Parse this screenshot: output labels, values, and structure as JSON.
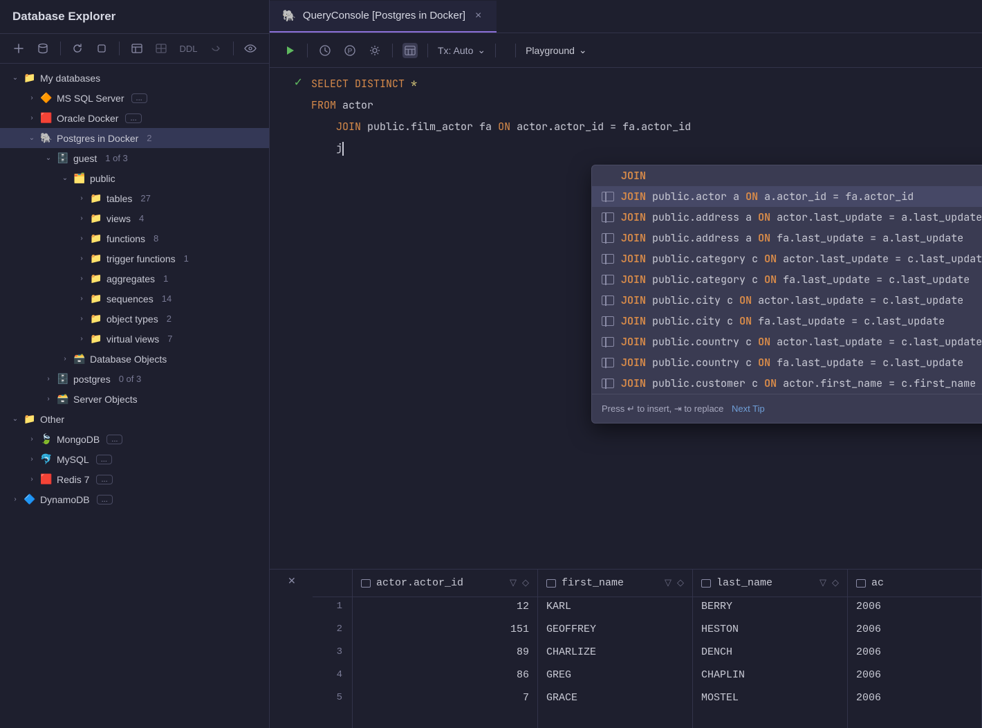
{
  "sidebar": {
    "title": "Database Explorer",
    "toolbar": {
      "ddl": "DDL"
    },
    "tree": [
      {
        "depth": 0,
        "expanded": true,
        "icon": "folder",
        "label": "My databases"
      },
      {
        "depth": 1,
        "expanded": false,
        "icon": "mssql",
        "label": "MS SQL Server",
        "badge": "..."
      },
      {
        "depth": 1,
        "expanded": false,
        "icon": "oracle",
        "label": "Oracle Docker",
        "badge": "..."
      },
      {
        "depth": 1,
        "expanded": true,
        "icon": "postgres",
        "label": "Postgres in Docker",
        "count": "2",
        "selected": true
      },
      {
        "depth": 2,
        "expanded": true,
        "icon": "db",
        "label": "guest",
        "count": "1 of 3"
      },
      {
        "depth": 3,
        "expanded": true,
        "icon": "schema",
        "label": "public"
      },
      {
        "depth": 4,
        "expanded": false,
        "icon": "folder",
        "label": "tables",
        "count": "27"
      },
      {
        "depth": 4,
        "expanded": false,
        "icon": "folder",
        "label": "views",
        "count": "4"
      },
      {
        "depth": 4,
        "expanded": false,
        "icon": "folder",
        "label": "functions",
        "count": "8"
      },
      {
        "depth": 4,
        "expanded": false,
        "icon": "folder",
        "label": "trigger functions",
        "count": "1"
      },
      {
        "depth": 4,
        "expanded": false,
        "icon": "folder",
        "label": "aggregates",
        "count": "1"
      },
      {
        "depth": 4,
        "expanded": false,
        "icon": "folder",
        "label": "sequences",
        "count": "14"
      },
      {
        "depth": 4,
        "expanded": false,
        "icon": "folder",
        "label": "object types",
        "count": "2"
      },
      {
        "depth": 4,
        "expanded": false,
        "icon": "folder",
        "label": "virtual views",
        "count": "7"
      },
      {
        "depth": 3,
        "expanded": false,
        "icon": "dbobj",
        "label": "Database Objects"
      },
      {
        "depth": 2,
        "expanded": false,
        "icon": "db",
        "label": "postgres",
        "count": "0 of 3"
      },
      {
        "depth": 2,
        "expanded": false,
        "icon": "srvobj",
        "label": "Server Objects"
      },
      {
        "depth": 0,
        "expanded": true,
        "icon": "folder",
        "label": "Other"
      },
      {
        "depth": 1,
        "expanded": false,
        "icon": "mongo",
        "label": "MongoDB",
        "badge": "..."
      },
      {
        "depth": 1,
        "expanded": false,
        "icon": "mysql",
        "label": "MySQL",
        "badge": "..."
      },
      {
        "depth": 1,
        "expanded": false,
        "icon": "redis",
        "label": "Redis 7",
        "badge": "..."
      },
      {
        "depth": 0,
        "expanded": false,
        "icon": "dynamo",
        "label": "DynamoDB",
        "badge": "..."
      }
    ]
  },
  "tab": {
    "label": "QueryConsole [Postgres in Docker]"
  },
  "toolbar": {
    "tx": "Tx: Auto",
    "playground": "Playground"
  },
  "editor": {
    "line1_kw1": "SELECT",
    "line1_kw2": "DISTINCT",
    "line2_kw": "FROM",
    "line2_ident": "actor",
    "line3_kw1": "JOIN",
    "line3_ident1": "public.film_actor fa",
    "line3_kw2": "ON",
    "line3_ident2": "actor.actor_id = fa.actor_id",
    "line4_typed": "j"
  },
  "autocomplete": {
    "keyword_item": "JOIN",
    "items": [
      "JOIN public.actor a ON a.actor_id = fa.actor_id",
      "JOIN public.address a ON actor.last_update = a.last_update",
      "JOIN public.address a ON fa.last_update = a.last_update",
      "JOIN public.category c ON actor.last_update = c.last_update",
      "JOIN public.category c ON fa.last_update = c.last_update",
      "JOIN public.city c ON actor.last_update = c.last_update",
      "JOIN public.city c ON fa.last_update = c.last_update",
      "JOIN public.country c ON actor.last_update = c.last_update",
      "JOIN public.country c ON fa.last_update = c.last_update",
      "JOIN public.customer c ON actor.first_name = c.first_name"
    ],
    "footer_hint": "Press ↵ to insert, ⇥ to replace",
    "footer_link": "Next Tip"
  },
  "results": {
    "columns": [
      "actor.actor_id",
      "first_name",
      "last_name",
      "ac"
    ],
    "rows": [
      {
        "n": "1",
        "id": "12",
        "first": "KARL",
        "last": "BERRY",
        "next": "2006"
      },
      {
        "n": "2",
        "id": "151",
        "first": "GEOFFREY",
        "last": "HESTON",
        "next": "2006"
      },
      {
        "n": "3",
        "id": "89",
        "first": "CHARLIZE",
        "last": "DENCH",
        "next": "2006"
      },
      {
        "n": "4",
        "id": "86",
        "first": "GREG",
        "last": "CHAPLIN",
        "next": "2006"
      },
      {
        "n": "5",
        "id": "7",
        "first": "GRACE",
        "last": "MOSTEL",
        "next": "2006"
      }
    ]
  }
}
